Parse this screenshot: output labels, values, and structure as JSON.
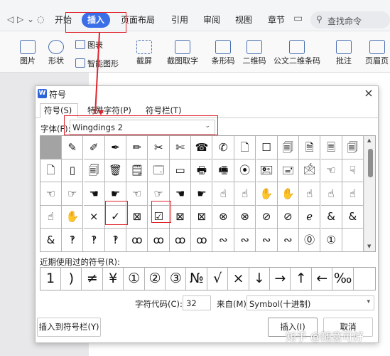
{
  "menubar": {
    "quick_icons": [
      "◁",
      "▷",
      "⌄",
      "◌"
    ],
    "tabs": [
      "开始",
      "插入",
      "页面布局",
      "引用",
      "审阅",
      "视图",
      "章节"
    ],
    "active_tab": "插入",
    "search_placeholder": "查找命令"
  },
  "toolbar": {
    "items": [
      {
        "label": "图片",
        "icon": "picture-icon"
      },
      {
        "label": "形状",
        "icon": "shapes-icon"
      },
      {
        "label": "图表",
        "icon": "chart-icon"
      },
      {
        "label": "智能图形",
        "icon": "smartart-icon"
      },
      {
        "label": "截屏",
        "icon": "screenshot-icon"
      },
      {
        "label": "截图取字",
        "icon": "ocr-icon"
      },
      {
        "label": "条形码",
        "icon": "barcode-icon"
      },
      {
        "label": "二维码",
        "icon": "qrcode-icon"
      },
      {
        "label": "公文二维条码",
        "icon": "doc-qrcode-icon"
      },
      {
        "label": "批注",
        "icon": "comment-icon"
      },
      {
        "label": "页眉页",
        "icon": "header-icon"
      }
    ]
  },
  "dialog": {
    "title": "符号",
    "logo": "W",
    "close": "×",
    "tabs": [
      "符号(S)",
      "特殊字符(P)",
      "符号栏(T)"
    ],
    "font_label": "字体(F):",
    "font_value": "Wingdings 2",
    "symbols": [
      [
        "",
        "✎",
        "✐",
        "✒",
        "✏",
        "✂",
        "✄",
        "☎",
        "✆",
        "🗋",
        "☐",
        "🗐",
        "🗎",
        "🗏",
        "🗐"
      ],
      [
        "🗋",
        "▯",
        "🗐",
        "🗑",
        "🗒",
        "🗔",
        "▭",
        "🖶",
        "🖷",
        "⦿",
        "🖭",
        "🖃",
        "🖄",
        "☜",
        "☟"
      ],
      [
        "☜",
        "☞",
        "☚",
        "☛",
        "☜",
        "☞",
        "☚",
        "☛",
        "☝",
        "☝",
        "✋",
        "✋",
        "☝",
        "☝",
        "☝"
      ],
      [
        "☝",
        "✋",
        "×",
        "✓",
        "⊠",
        "☑",
        "⊠",
        "⊠",
        "⊗",
        "⊗",
        "⊘",
        "⊘",
        "ℯ",
        "&",
        "&"
      ],
      [
        "&",
        "‽",
        "‽",
        "‽",
        "ꝏ",
        "ꝏ",
        "ꝏ",
        "ꝏ",
        "∾",
        "∾",
        "∾",
        "∾",
        "⓪",
        "①",
        ""
      ]
    ],
    "recent_label": "近期使用过的符号(R):",
    "recent": [
      "1",
      ")",
      "≠",
      "¥",
      "①",
      "②",
      "③",
      "№",
      "√",
      "×",
      "↓",
      "→",
      "↑",
      "←",
      "‰"
    ],
    "code_label": "字符代码(C):",
    "code_value": "32",
    "from_label": "来自(M)",
    "from_value": "Symbol(十进制)",
    "btn_insert_bar": "插入到符号栏(Y)",
    "btn_insert": "插入(I)",
    "btn_cancel": "取消"
  },
  "watermark": "知乎 @随意可好",
  "colors": {
    "accent": "#3a6fe8",
    "annotation": "#e0242e"
  }
}
